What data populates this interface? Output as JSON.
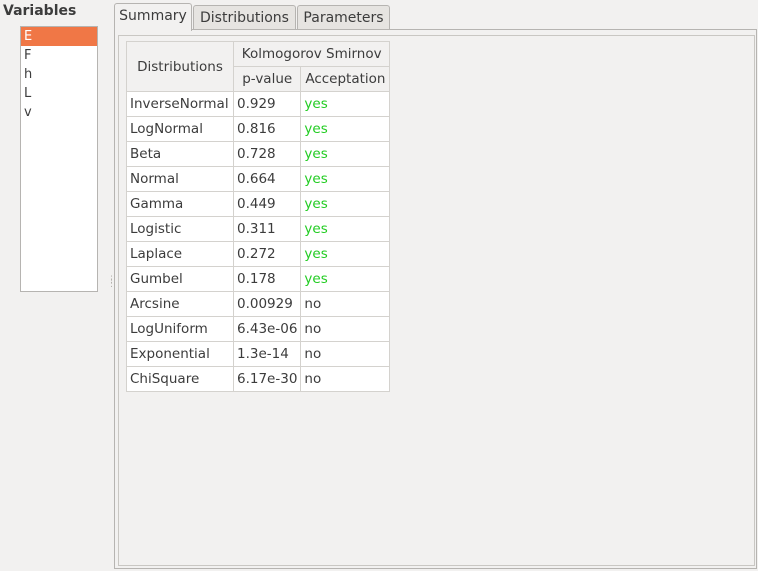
{
  "variables": {
    "title": "Variables",
    "items": [
      "E",
      "F",
      "h",
      "L",
      "v"
    ],
    "selected": "E"
  },
  "tabs": [
    "Summary",
    "Distributions",
    "Parameters"
  ],
  "active_tab": "Summary",
  "table": {
    "header": {
      "distributions": "Distributions",
      "group": "Kolmogorov Smirnov",
      "pvalue": "p-value",
      "acceptation": "Acceptation"
    },
    "rows": [
      {
        "name": "InverseNormal",
        "pvalue": "0.929",
        "accept": "yes"
      },
      {
        "name": "LogNormal",
        "pvalue": "0.816",
        "accept": "yes"
      },
      {
        "name": "Beta",
        "pvalue": "0.728",
        "accept": "yes"
      },
      {
        "name": "Normal",
        "pvalue": "0.664",
        "accept": "yes"
      },
      {
        "name": "Gamma",
        "pvalue": "0.449",
        "accept": "yes"
      },
      {
        "name": "Logistic",
        "pvalue": "0.311",
        "accept": "yes"
      },
      {
        "name": "Laplace",
        "pvalue": "0.272",
        "accept": "yes"
      },
      {
        "name": "Gumbel",
        "pvalue": "0.178",
        "accept": "yes"
      },
      {
        "name": "Arcsine",
        "pvalue": "0.00929",
        "accept": "no"
      },
      {
        "name": "LogUniform",
        "pvalue": "6.43e-06",
        "accept": "no"
      },
      {
        "name": "Exponential",
        "pvalue": "1.3e-14",
        "accept": "no"
      },
      {
        "name": "ChiSquare",
        "pvalue": "6.17e-30",
        "accept": "no"
      }
    ]
  },
  "colors": {
    "selection": "#f07746",
    "accepted": "#22cc22"
  }
}
